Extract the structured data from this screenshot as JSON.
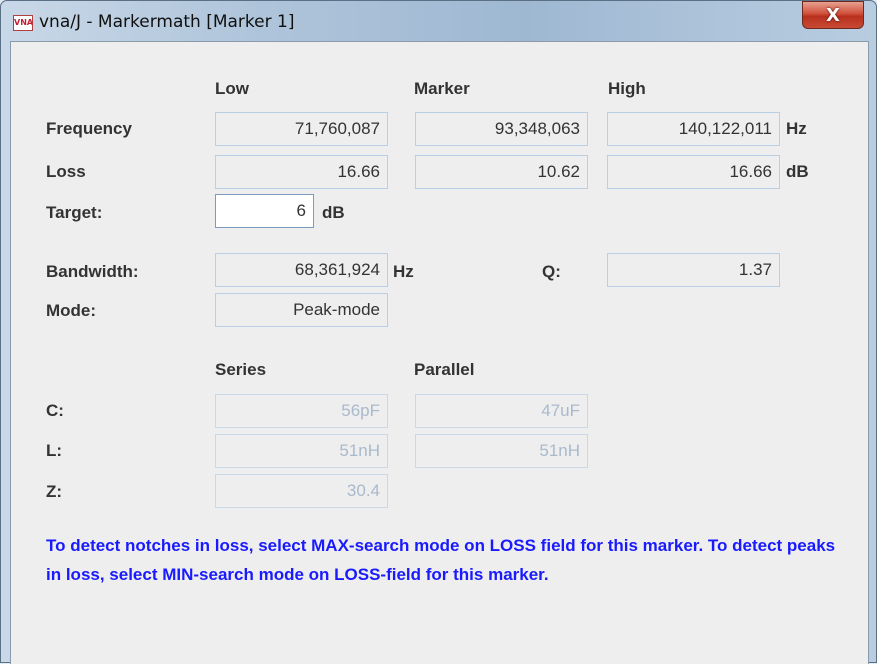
{
  "window": {
    "title": "vna/J - Markermath [Marker 1]",
    "icon_name": "vnaj-app-icon",
    "close_label": "X"
  },
  "headers": {
    "low": "Low",
    "marker": "Marker",
    "high": "High"
  },
  "frequency": {
    "label": "Frequency",
    "low": "71,760,087",
    "marker": "93,348,063",
    "high": "140,122,011",
    "unit": "Hz"
  },
  "loss": {
    "label": "Loss",
    "low": "16.66",
    "marker": "10.62",
    "high": "16.66",
    "unit": "dB"
  },
  "target": {
    "label": "Target:",
    "value": "6",
    "unit": "dB"
  },
  "bandwidth": {
    "label": "Bandwidth:",
    "value": "68,361,924",
    "unit": "Hz"
  },
  "q": {
    "label": "Q:",
    "value": "1.37"
  },
  "mode": {
    "label": "Mode:",
    "value": "Peak-mode"
  },
  "circuit_headers": {
    "series": "Series",
    "parallel": "Parallel"
  },
  "c": {
    "label": "C:",
    "series": "56pF",
    "parallel": "47uF"
  },
  "l": {
    "label": "L:",
    "series": "51nH",
    "parallel": "51nH"
  },
  "z": {
    "label": "Z:",
    "series": "30.4"
  },
  "info_text": "To detect notches in loss, select MAX-search mode on LOSS field for this marker. To detect peaks in loss, select MIN-search mode on LOSS-field for this marker.",
  "colors": {
    "info_text": "#1a1aff",
    "disabled_text": "#a9b9cc"
  }
}
